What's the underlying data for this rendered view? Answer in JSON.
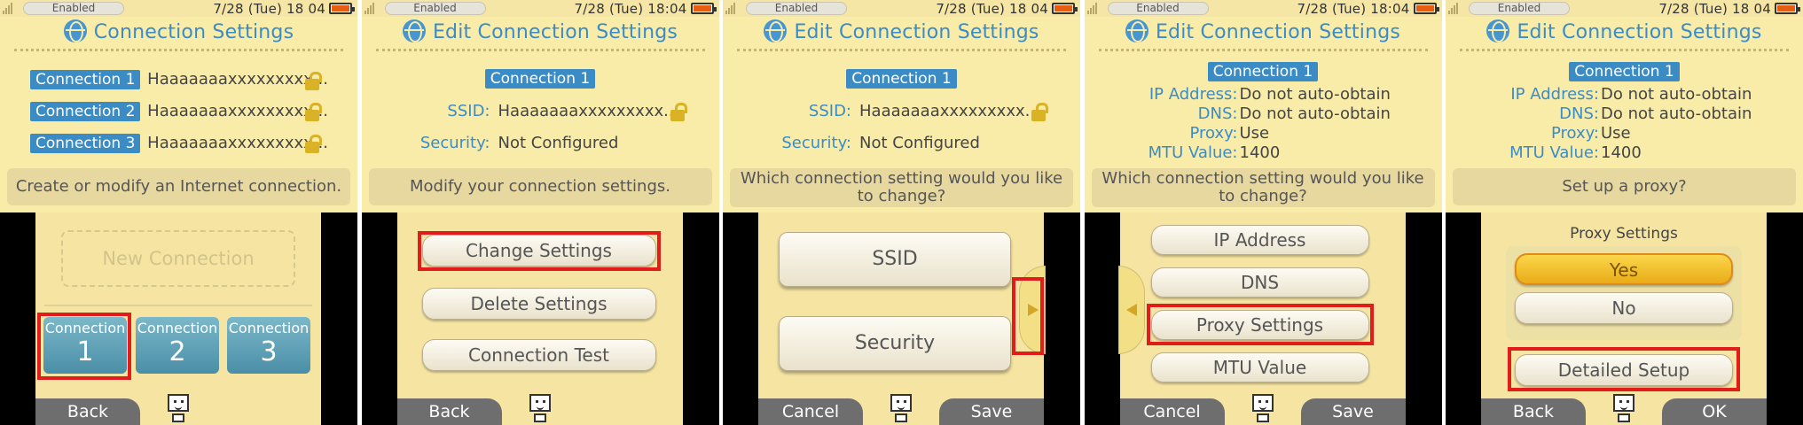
{
  "status": {
    "enabled": "Enabled",
    "time": "7/28 (Tue) 18 04",
    "time_colon": "7/28 (Tue) 18:04"
  },
  "colors": {
    "accent_blue": "#3a8cc9",
    "highlight_red": "#e21b1b",
    "top_bg": "#f9eba8",
    "touch_bg": "#f6e5a2"
  },
  "icons": {
    "title": "globe-wrench-icon",
    "lock": "unlock-icon",
    "assistant": "mascot-face-icon"
  },
  "p1": {
    "title": "Connection Settings",
    "connections": [
      {
        "tag": "Connection 1",
        "ssid": "Haaaaaaaxxxxxxxxx..."
      },
      {
        "tag": "Connection 2",
        "ssid": "Haaaaaaaxxxxxxxxx..."
      },
      {
        "tag": "Connection 3",
        "ssid": "Haaaaaaaxxxxxxxxx..."
      }
    ],
    "message": "Create or modify an Internet connection.",
    "new_connection": "New Connection",
    "slots": [
      {
        "label": "Connection",
        "num": "1"
      },
      {
        "label": "Connection",
        "num": "2"
      },
      {
        "label": "Connection",
        "num": "3"
      }
    ],
    "back": "Back"
  },
  "p2": {
    "title": "Edit Connection Settings",
    "tag": "Connection 1",
    "ssid_label": "SSID:",
    "ssid_value": "Haaaaaaaxxxxxxxxx...",
    "security_label": "Security:",
    "security_value": "Not Configured",
    "message": "Modify your connection settings.",
    "buttons": [
      "Change Settings",
      "Delete Settings",
      "Connection Test"
    ],
    "back": "Back"
  },
  "p3": {
    "title": "Edit Connection Settings",
    "tag": "Connection 1",
    "ssid_label": "SSID:",
    "ssid_value": "Haaaaaaaxxxxxxxxx...",
    "security_label": "Security:",
    "security_value": "Not Configured",
    "message_line1": "Which connection setting would you like",
    "message_line2": "to change?",
    "buttons": [
      "SSID",
      "Security"
    ],
    "cancel": "Cancel",
    "save": "Save"
  },
  "p4": {
    "title": "Edit Connection Settings",
    "tag": "Connection 1",
    "rows": [
      {
        "k": "IP Address:",
        "v": "Do not auto-obtain"
      },
      {
        "k": "DNS:",
        "v": "Do not auto-obtain"
      },
      {
        "k": "Proxy:",
        "v": "Use"
      },
      {
        "k": "MTU Value:",
        "v": "1400"
      }
    ],
    "message_line1": "Which connection setting would you like",
    "message_line2": "to change?",
    "buttons": [
      "IP Address",
      "DNS",
      "Proxy Settings",
      "MTU Value"
    ],
    "cancel": "Cancel",
    "save": "Save"
  },
  "p5": {
    "title": "Edit Connection Settings",
    "tag": "Connection 1",
    "rows": [
      {
        "k": "IP Address:",
        "v": "Do not auto-obtain"
      },
      {
        "k": "DNS:",
        "v": "Do not auto-obtain"
      },
      {
        "k": "Proxy:",
        "v": "Use"
      },
      {
        "k": "MTU Value:",
        "v": "1400"
      }
    ],
    "message": "Set up a proxy?",
    "proxy_heading": "Proxy Settings",
    "yes": "Yes",
    "no": "No",
    "detailed": "Detailed Setup",
    "back": "Back",
    "ok": "OK"
  }
}
